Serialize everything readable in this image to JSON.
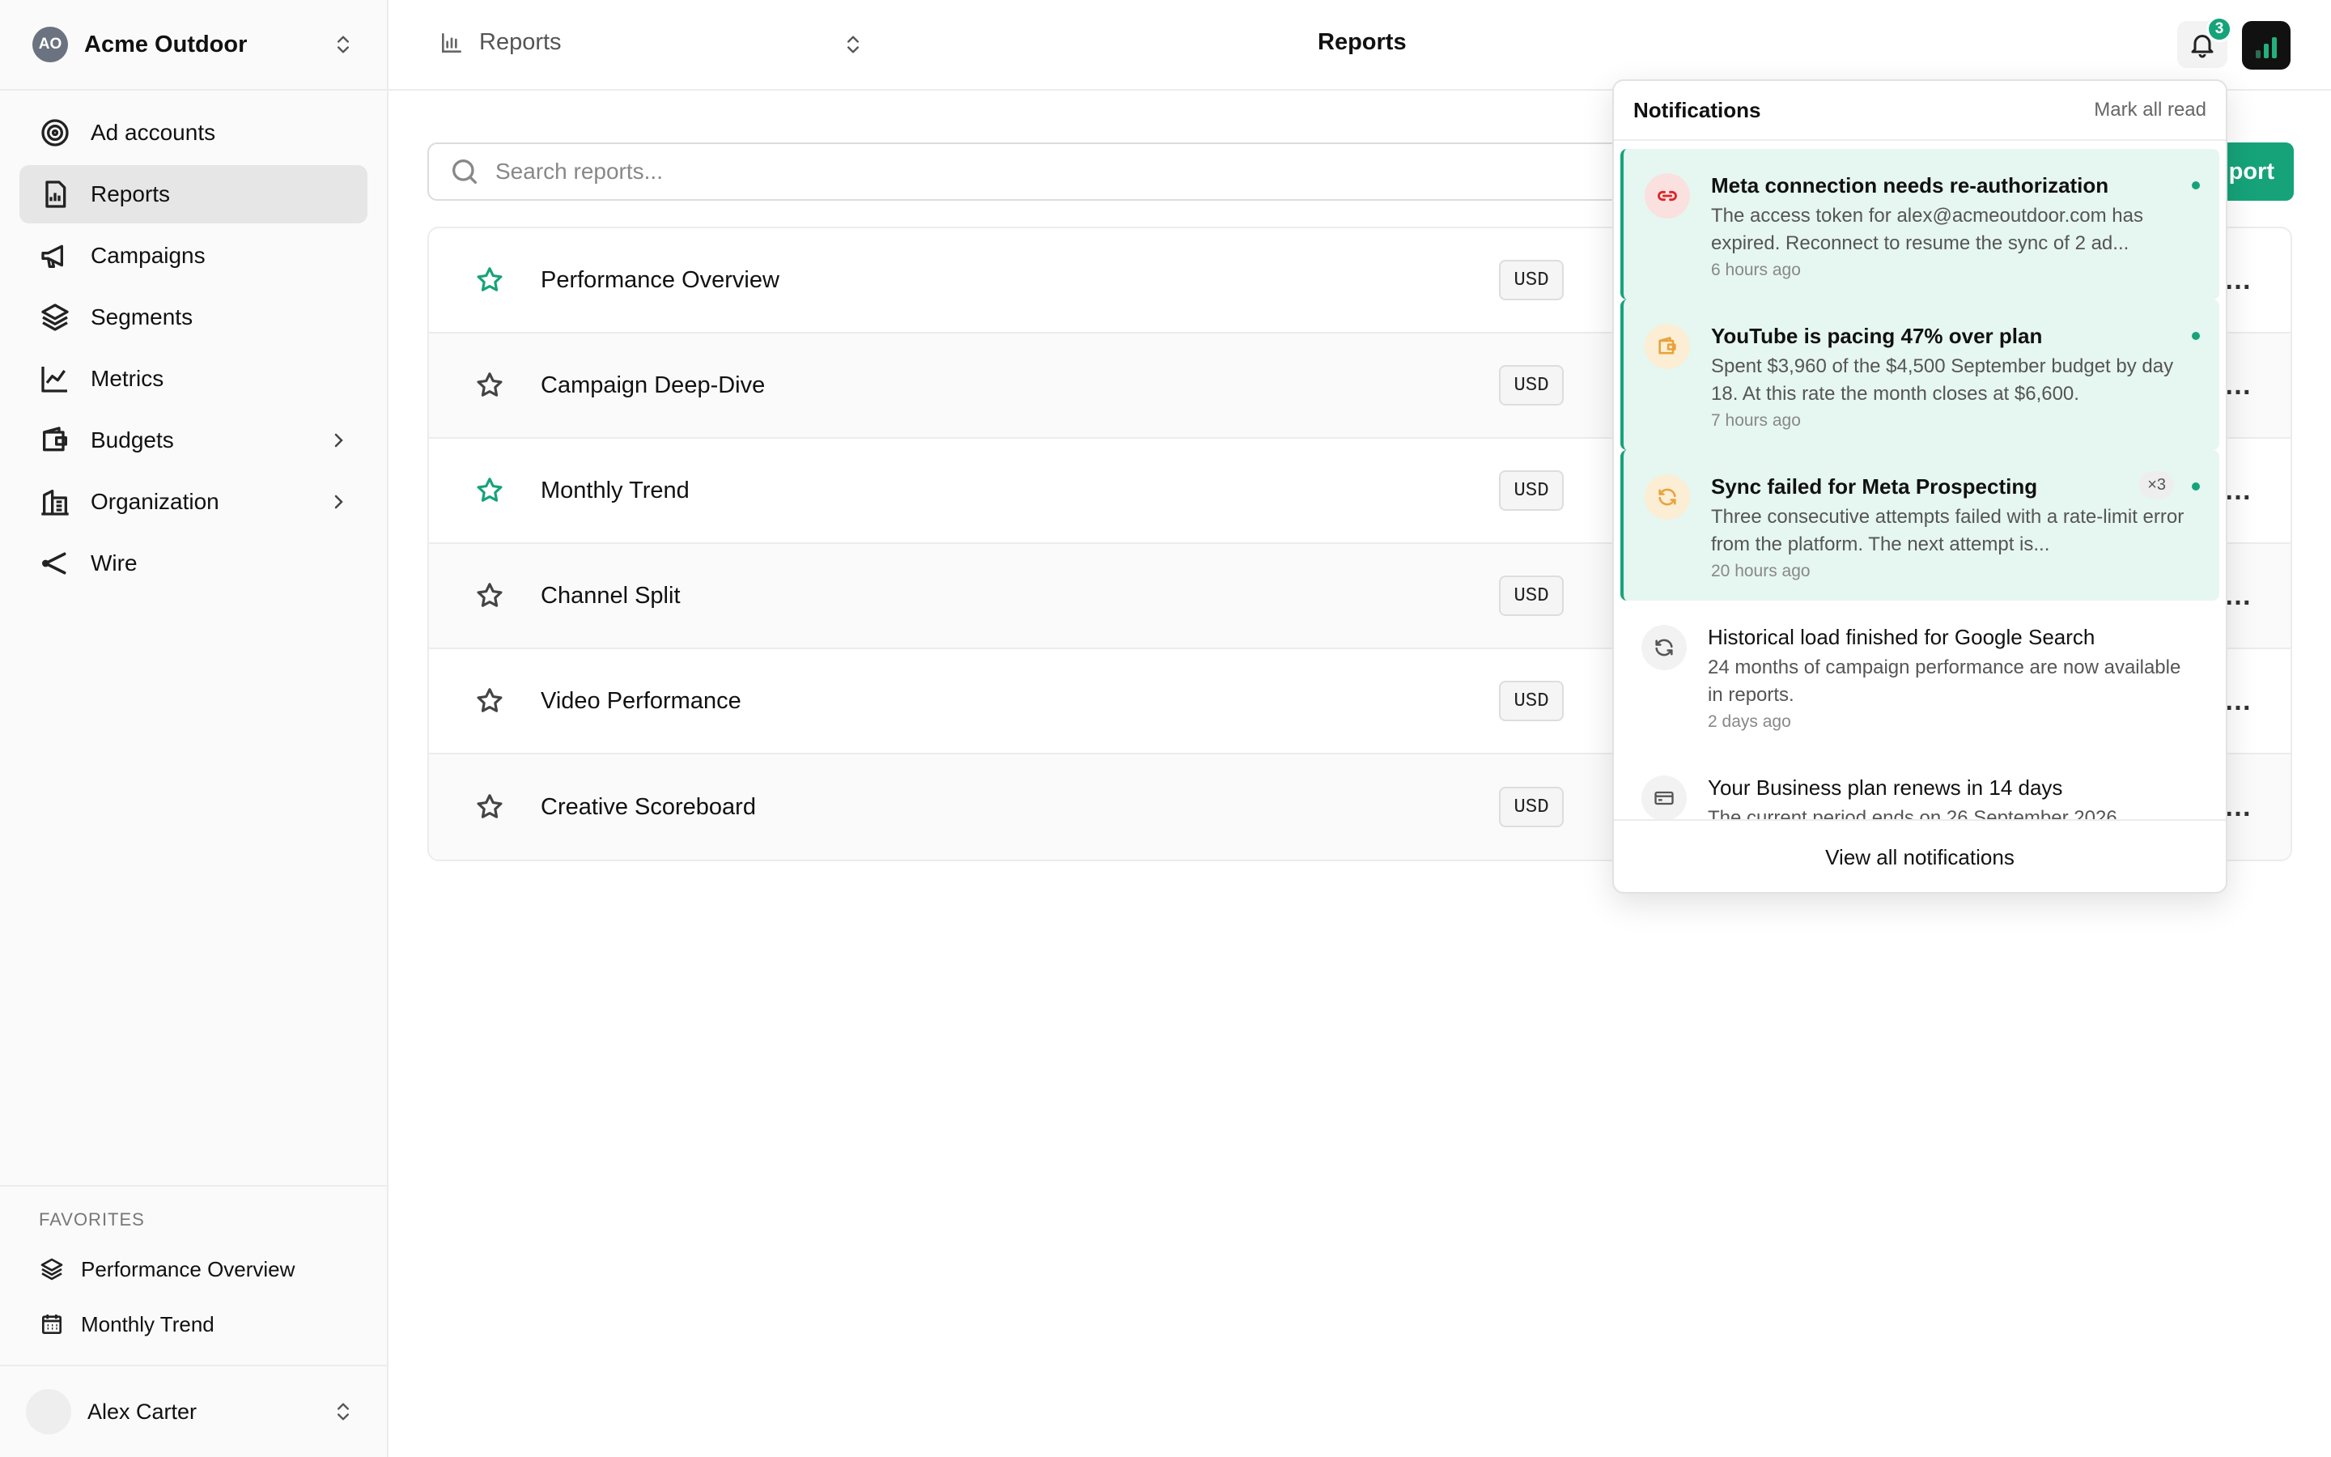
{
  "org": {
    "initials": "AO",
    "name": "Acme Outdoor"
  },
  "nav": {
    "items": [
      {
        "label": "Ad accounts",
        "icon": "target-icon"
      },
      {
        "label": "Reports",
        "icon": "report-icon"
      },
      {
        "label": "Campaigns",
        "icon": "megaphone-icon"
      },
      {
        "label": "Segments",
        "icon": "layers-icon"
      },
      {
        "label": "Metrics",
        "icon": "line-chart-icon"
      },
      {
        "label": "Budgets",
        "icon": "wallet-icon"
      },
      {
        "label": "Organization",
        "icon": "building-icon"
      },
      {
        "label": "Wire",
        "icon": "share-icon"
      }
    ]
  },
  "favorites": {
    "title": "FAVORITES",
    "items": [
      {
        "label": "Performance Overview",
        "icon": "layers-icon"
      },
      {
        "label": "Monthly Trend",
        "icon": "calendar-icon"
      }
    ]
  },
  "user": {
    "name": "Alex Carter"
  },
  "topbar": {
    "breadcrumb": "Reports",
    "title": "Reports",
    "notification_count": "3"
  },
  "search": {
    "placeholder": "Search reports..."
  },
  "toolbar": {
    "new_button_label": "port"
  },
  "reports": [
    {
      "name": "Performance Overview",
      "currency": "USD",
      "starred": true
    },
    {
      "name": "Campaign Deep-Dive",
      "currency": "USD",
      "starred": false
    },
    {
      "name": "Monthly Trend",
      "currency": "USD",
      "starred": true
    },
    {
      "name": "Channel Split",
      "currency": "USD",
      "starred": false
    },
    {
      "name": "Video Performance",
      "currency": "USD",
      "starred": false
    },
    {
      "name": "Creative Scoreboard",
      "currency": "USD",
      "starred": false
    }
  ],
  "notifications": {
    "title": "Notifications",
    "mark_all_read": "Mark all read",
    "view_all": "View all notifications",
    "items": [
      {
        "title": "Meta connection needs re-authorization",
        "body": "The access token for alex@acmeoutdoor.com has expired. Reconnect to resume the sync of 2 ad...",
        "time": "6 hours ago",
        "icon": "link-icon",
        "unread": true
      },
      {
        "title": "YouTube is pacing 47% over plan",
        "body": "Spent $3,960 of the $4,500 September budget by day 18. At this rate the month closes at $6,600.",
        "time": "7 hours ago",
        "icon": "wallet-icon",
        "unread": true
      },
      {
        "title": "Sync failed for Meta Prospecting",
        "body": "Three consecutive attempts failed with a rate-limit error from the platform. The next attempt is...",
        "time": "20 hours ago",
        "icon": "refresh-icon",
        "count": "×3",
        "unread": true
      },
      {
        "title": "Historical load finished for Google Search",
        "body": "24 months of campaign performance are now available in reports.",
        "time": "2 days ago",
        "icon": "refresh-icon",
        "unread": false
      },
      {
        "title": "Your Business plan renews in 14 days",
        "body": "The current period ends on 26 September 2026.",
        "time": "",
        "icon": "card-icon",
        "unread": false
      }
    ]
  },
  "colors": {
    "accent": "#16a37a",
    "unread_bg": "#e6f6f0",
    "error": "#dc2626",
    "warning": "#e9a23b"
  }
}
